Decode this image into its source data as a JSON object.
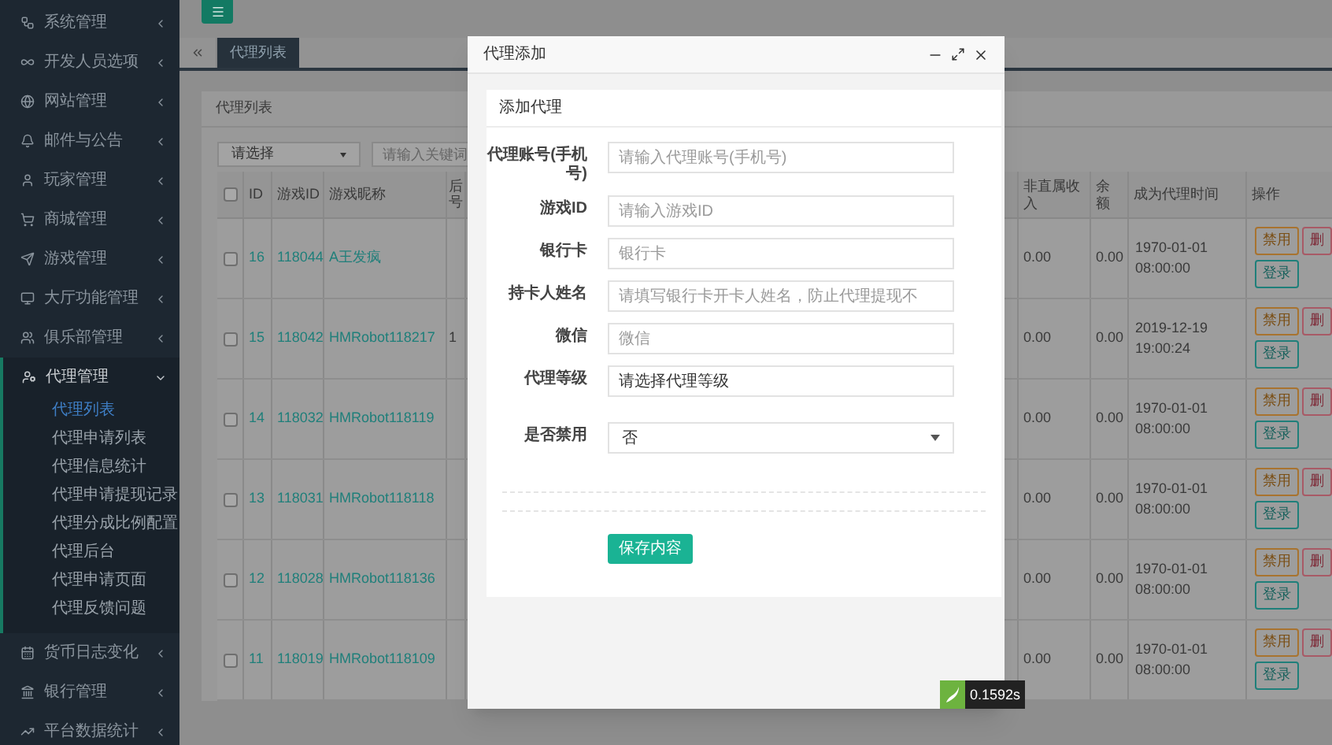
{
  "sidebar": {
    "items": [
      {
        "label": "系统管理",
        "expanded": false
      },
      {
        "label": "开发人员选项",
        "expanded": false
      },
      {
        "label": "网站管理",
        "expanded": false
      },
      {
        "label": "邮件与公告",
        "expanded": false
      },
      {
        "label": "玩家管理",
        "expanded": false
      },
      {
        "label": "商城管理",
        "expanded": false
      },
      {
        "label": "游戏管理",
        "expanded": false
      },
      {
        "label": "大厅功能管理",
        "expanded": false
      },
      {
        "label": "俱乐部管理",
        "expanded": false
      },
      {
        "label": "代理管理",
        "expanded": true,
        "children": [
          {
            "label": "代理列表",
            "selected": true
          },
          {
            "label": "代理申请列表",
            "selected": false
          },
          {
            "label": "代理信息统计",
            "selected": false
          },
          {
            "label": "代理申请提现记录",
            "selected": false
          },
          {
            "label": "代理分成比例配置",
            "selected": false
          },
          {
            "label": "代理后台",
            "selected": false
          },
          {
            "label": "代理申请页面",
            "selected": false
          },
          {
            "label": "代理反馈问题",
            "selected": false
          }
        ]
      },
      {
        "label": "货币日志变化",
        "expanded": false
      },
      {
        "label": "银行管理",
        "expanded": false
      },
      {
        "label": "平台数据统计",
        "expanded": false
      }
    ]
  },
  "tabs": [
    {
      "label": "代理列表",
      "selected": true
    }
  ],
  "panel": {
    "title": "代理列表",
    "filter": {
      "select": "请选择",
      "search_placeholder": "请输入关键词"
    },
    "table": {
      "select_all": {
        "checked": false
      },
      "left_columns": [
        "ID",
        "游戏ID",
        "游戏昵称",
        "后号"
      ],
      "right_columns": [
        "非直属收入",
        "余额",
        "成为代理时间",
        "操作"
      ],
      "rows": [
        {
          "checked": false,
          "id": "16",
          "game_id": "118044",
          "nickname": "A王发疯",
          "non_direct_income": "0.00",
          "balance": "0.00",
          "agent_time": "1970-01-01 08:00:00",
          "actions": [
            {
              "kind": "disable",
              "label": "禁用"
            },
            {
              "kind": "delete",
              "label": "删"
            },
            {
              "kind": "login",
              "label": "登录"
            }
          ]
        },
        {
          "checked": false,
          "id": "15",
          "game_id": "118042",
          "nickname": "HMRobot118217",
          "column_5": "1",
          "non_direct_income": "0.00",
          "balance": "0.00",
          "agent_time": "2019-12-19 19:00:24",
          "actions": [
            {
              "kind": "disable",
              "label": "禁用"
            },
            {
              "kind": "delete",
              "label": "删"
            },
            {
              "kind": "login",
              "label": "登录"
            }
          ]
        },
        {
          "checked": false,
          "id": "14",
          "game_id": "118032",
          "nickname": "HMRobot118119",
          "non_direct_income": "0.00",
          "balance": "0.00",
          "agent_time": "1970-01-01 08:00:00",
          "actions": [
            {
              "kind": "disable",
              "label": "禁用"
            },
            {
              "kind": "delete",
              "label": "删"
            },
            {
              "kind": "login",
              "label": "登录"
            }
          ]
        },
        {
          "checked": false,
          "id": "13",
          "game_id": "118031",
          "nickname": "HMRobot118118",
          "non_direct_income": "0.00",
          "balance": "0.00",
          "agent_time": "1970-01-01 08:00:00",
          "actions": [
            {
              "kind": "disable",
              "label": "禁用"
            },
            {
              "kind": "delete",
              "label": "删"
            },
            {
              "kind": "login",
              "label": "登录"
            }
          ]
        },
        {
          "checked": false,
          "id": "12",
          "game_id": "118028",
          "nickname": "HMRobot118136",
          "non_direct_income": "0.00",
          "balance": "0.00",
          "agent_time": "1970-01-01 08:00:00",
          "actions": [
            {
              "kind": "disable",
              "label": "禁用"
            },
            {
              "kind": "delete",
              "label": "删"
            },
            {
              "kind": "login",
              "label": "登录"
            }
          ]
        },
        {
          "checked": false,
          "id": "11",
          "game_id": "118019",
          "nickname": "HMRobot118109",
          "non_direct_income": "0.00",
          "balance": "0.00",
          "agent_time": "1970-01-01 08:00:00",
          "actions": [
            {
              "kind": "disable",
              "label": "禁用"
            },
            {
              "kind": "delete",
              "label": "删"
            },
            {
              "kind": "login",
              "label": "登录"
            }
          ]
        }
      ]
    }
  },
  "modal": {
    "title": "代理添加",
    "form_title": "添加代理",
    "fields": [
      {
        "kind": "input",
        "label": "代理账号(手机号)",
        "placeholder": "请输入代理账号(手机号)"
      },
      {
        "kind": "input",
        "label": "游戏ID",
        "placeholder": "请输入游戏ID"
      },
      {
        "kind": "input",
        "label": "银行卡",
        "placeholder": "银行卡"
      },
      {
        "kind": "input",
        "label": "持卡人姓名",
        "placeholder": "请填写银行卡开卡人姓名，防止代理提现不"
      },
      {
        "kind": "input",
        "label": "微信",
        "placeholder": "微信"
      },
      {
        "kind": "input",
        "label": "代理等级",
        "value": "请选择代理等级"
      },
      {
        "kind": "select",
        "label": "是否禁用",
        "value": "否"
      }
    ],
    "save_button": "保存内容"
  },
  "timing_badge": "0.1592s"
}
